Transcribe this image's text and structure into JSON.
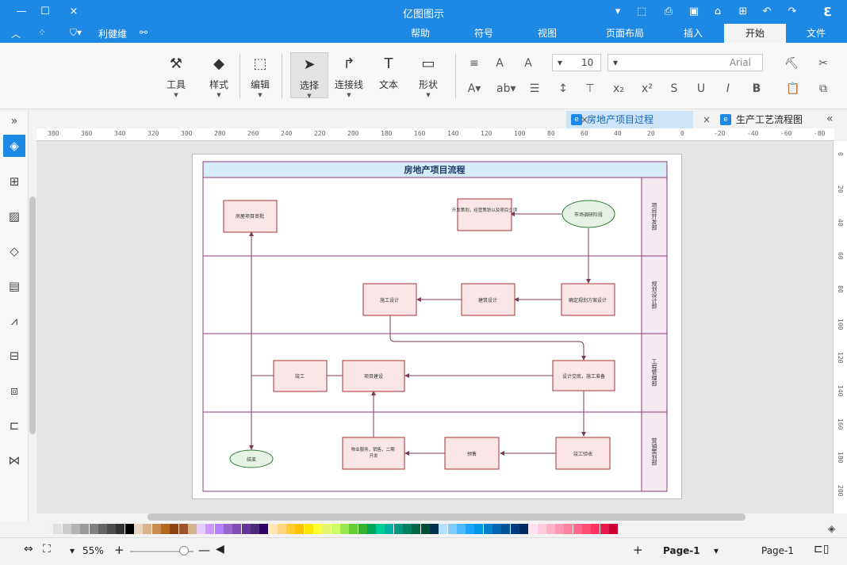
{
  "app": {
    "title": "亿图图示"
  },
  "titlebar": {
    "left_icons": [
      "minimize-icon",
      "maximize-icon",
      "close-icon"
    ],
    "right_icons": [
      "redo-icon",
      "undo-icon",
      "new-icon",
      "open-icon",
      "save-icon",
      "print-icon",
      "export-icon",
      "dropdown-icon",
      "app-logo-icon"
    ]
  },
  "menubar": {
    "tabs": [
      {
        "label": "文件",
        "active": false
      },
      {
        "label": "开始",
        "active": true
      },
      {
        "label": "插入",
        "active": false
      },
      {
        "label": "页面布局",
        "active": false
      },
      {
        "label": "视图",
        "active": false
      },
      {
        "label": "符号",
        "active": false
      },
      {
        "label": "帮助",
        "active": false
      }
    ],
    "user_label": "利健维",
    "share_icon": "share-icon"
  },
  "ribbon": {
    "tools": [
      {
        "label": "形状",
        "icon": "shape-icon"
      },
      {
        "label": "文本",
        "icon": "text-icon"
      },
      {
        "label": "连接线",
        "icon": "connector-icon"
      },
      {
        "label": "选择",
        "icon": "select-icon"
      },
      {
        "label": "编辑",
        "icon": "edit-icon"
      },
      {
        "label": "样式",
        "icon": "style-icon"
      },
      {
        "label": "工具",
        "icon": "tools-icon"
      }
    ],
    "font_name": "Arial",
    "font_size": "10"
  },
  "doc_tabs": [
    {
      "label": "生产工艺流程图",
      "active": false
    },
    {
      "label": "房地产项目过程",
      "active": true
    }
  ],
  "ruler": {
    "h_ticks": [
      "-80",
      "-60",
      "-40",
      "-20",
      "0",
      "20",
      "40",
      "60",
      "80",
      "100",
      "120",
      "140",
      "160",
      "180",
      "200",
      "220",
      "240",
      "260",
      "280",
      "300",
      "320",
      "340",
      "360",
      "380"
    ],
    "v_ticks": [
      "0",
      "20",
      "40",
      "60",
      "80",
      "100",
      "120",
      "140",
      "160",
      "180",
      "200"
    ]
  },
  "diagram": {
    "title": "房地产项目流程",
    "lanes": [
      "项目开发部",
      "规划设计部",
      "工程管理部",
      "营销策划部"
    ],
    "nodes": {
      "start": "市场调研阶段",
      "n1": "开发策划，经营策划以及项目立项",
      "n2": "房屋项目审批",
      "n3": "确定规划方案设计",
      "n4": "建筑设计",
      "n5": "施工设计",
      "n6": "设计交底，施工准备",
      "n7": "项目建设",
      "n8": "竣工",
      "n9": "竣工验收",
      "n10": "预售",
      "n11": "物业服务，销售，二期开发",
      "end": "结束"
    }
  },
  "palette_colors": [
    "#f2f2f2",
    "#e0e0e0",
    "#cccccc",
    "#b3b3b3",
    "#999999",
    "#808080",
    "#666666",
    "#4d4d4d",
    "#333333",
    "#000000",
    "#e8d6c4",
    "#d9b38c",
    "#c98b4f",
    "#b5651d",
    "#8b4513",
    "#a0522d",
    "#d2b48c",
    "#e6ccff",
    "#cc99ff",
    "#b380ff",
    "#9966cc",
    "#7f4fb3",
    "#663399",
    "#4b2a7a",
    "#330066",
    "#ffe6b3",
    "#ffd580",
    "#ffcc33",
    "#ffc000",
    "#ffe600",
    "#ffff33",
    "#e6f76d",
    "#ccff66",
    "#99e64d",
    "#66cc33",
    "#33b233",
    "#00a65a",
    "#00cc99",
    "#00b3a4",
    "#009980",
    "#008060",
    "#006644",
    "#004d33",
    "#00334d",
    "#b3e0ff",
    "#80ccff",
    "#4db8ff",
    "#1aa3ff",
    "#0099e6",
    "#0080cc",
    "#0066b3",
    "#005599",
    "#003d80",
    "#002966",
    "#ffe0f0",
    "#ffccdd",
    "#ffb3c8",
    "#ff99b3",
    "#ff809f",
    "#ff668a",
    "#ff4d75",
    "#ff3360",
    "#e6194b",
    "#cc0033"
  ],
  "statusbar": {
    "page_selector": "Page-1",
    "page_tab": "Page-1",
    "zoom": "55%"
  }
}
